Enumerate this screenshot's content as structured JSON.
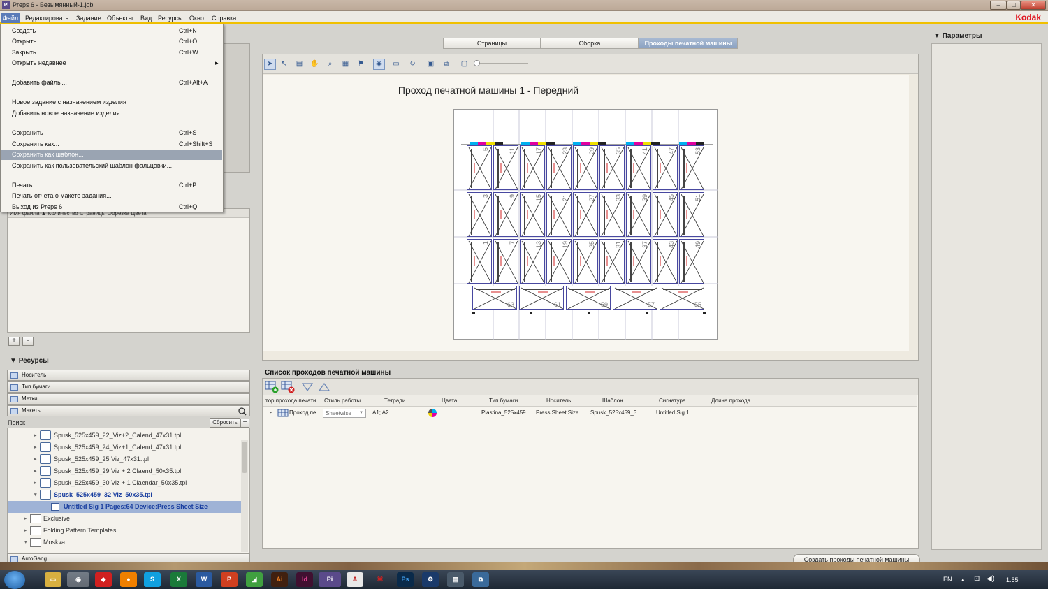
{
  "window": {
    "title": "Preps 6 - Безымянный-1.job",
    "app_icon": "Pi",
    "controls": [
      "–",
      "□",
      "✕"
    ]
  },
  "menubar": {
    "items": [
      "Файл",
      "Редактировать",
      "Задание",
      "Объекты",
      "Вид",
      "Ресурсы",
      "Окно",
      "Справка"
    ],
    "brand": "Kodak"
  },
  "file_menu": {
    "items": [
      {
        "label": "Создать",
        "shortcut": "Ctrl+N"
      },
      {
        "label": "Открыть...",
        "shortcut": "Ctrl+O"
      },
      {
        "label": "Закрыть",
        "shortcut": "Ctrl+W"
      },
      {
        "label": "Открыть недавнее",
        "shortcut": "▸"
      },
      {
        "label": "Добавить файлы...",
        "shortcut": "Ctrl+Alt+A"
      },
      {
        "label": "Новое задание с назначением изделия",
        "shortcut": ""
      },
      {
        "label": "Добавить новое назначение изделия",
        "shortcut": ""
      },
      {
        "label": "Сохранить",
        "shortcut": "Ctrl+S"
      },
      {
        "label": "Сохранить как...",
        "shortcut": "Ctrl+Shift+S"
      },
      {
        "label": "Сохранить как шаблон...",
        "shortcut": ""
      },
      {
        "label": "Сохранить как пользовательский шаблон фальцовки...",
        "shortcut": ""
      },
      {
        "label": "Печать...",
        "shortcut": "Ctrl+P"
      },
      {
        "label": "Печать отчета о макете задания...",
        "shortcut": ""
      },
      {
        "label": "Выход из Preps 6",
        "shortcut": "Ctrl+Q"
      }
    ]
  },
  "file_list": {
    "header": "Имя файла  ▲  Количество Страницы Обрезка Цвета",
    "add": "+",
    "remove": "-"
  },
  "resources": {
    "title": "Ресурсы",
    "sections": [
      "Носитель",
      "Тип бумаги",
      "Метки",
      "Макеты"
    ],
    "search_label": "Поиск",
    "reset_button": "Сбросить",
    "add_button": "+",
    "tree": [
      "Spusk_525x459_22_Viz+2_Calend_47x31.tpl",
      "Spusk_525x459_24_Viz+1_Calend_47x31.tpl",
      "Spusk_525x459_25 Viz_47x31.tpl",
      "Spusk_525x459_29 Viz + 2 Claend_50x35.tpl",
      "Spusk_525x459_30 Viz + 1 Claendar_50x35.tpl",
      "Spusk_525x459_32 Viz_50x35.tpl",
      "Untitled Sig 1  Pages:64  Device:Press Sheet Size",
      "Exclusive",
      "Folding Pattern Templates",
      "Moskva"
    ],
    "bottom_section": "AutoGang"
  },
  "tabs": [
    "Страницы",
    "Сборка",
    "Проходы печатной машины"
  ],
  "canvas": {
    "title": "Проход печатной машины 1 - Передний"
  },
  "sheet": {
    "rows": [
      [
        "5",
        "11",
        "17",
        "23",
        "29",
        "35",
        "41",
        "47",
        "53"
      ],
      [
        "3",
        "9",
        "15",
        "21",
        "27",
        "33",
        "39",
        "45",
        "51"
      ],
      [
        "1",
        "7",
        "13",
        "19",
        "25",
        "31",
        "37",
        "43",
        "49"
      ]
    ],
    "bottom_row": [
      "63",
      "61",
      "59",
      "57",
      "55"
    ]
  },
  "press_runs": {
    "title": "Список проходов печатной машины",
    "columns": [
      "тор прохода печати",
      "Стиль работы",
      "Тетради",
      "Цвета",
      "Тип бумаги",
      "Носитель",
      "Шаблон",
      "Сигнатура",
      "Длина прохода"
    ],
    "rows": [
      {
        "id": "Проход пе",
        "style": "Sheetwise",
        "sections": "A1; A2",
        "paper": "Plastina_525x459",
        "media": "Press Sheet Size",
        "template": "Spusk_525x459_3",
        "signature": "Untitled Sig 1",
        "length": ""
      }
    ]
  },
  "right_panel": {
    "title": "Параметры"
  },
  "create_button": "Создать проходы печатной машины",
  "taskbar": {
    "lang": "EN",
    "time": "1:55"
  },
  "colors": {
    "accent": "#f0c000",
    "selection": "#9fb3d6",
    "tab_active": "#8ba2c2",
    "brand": "#e0141e"
  }
}
